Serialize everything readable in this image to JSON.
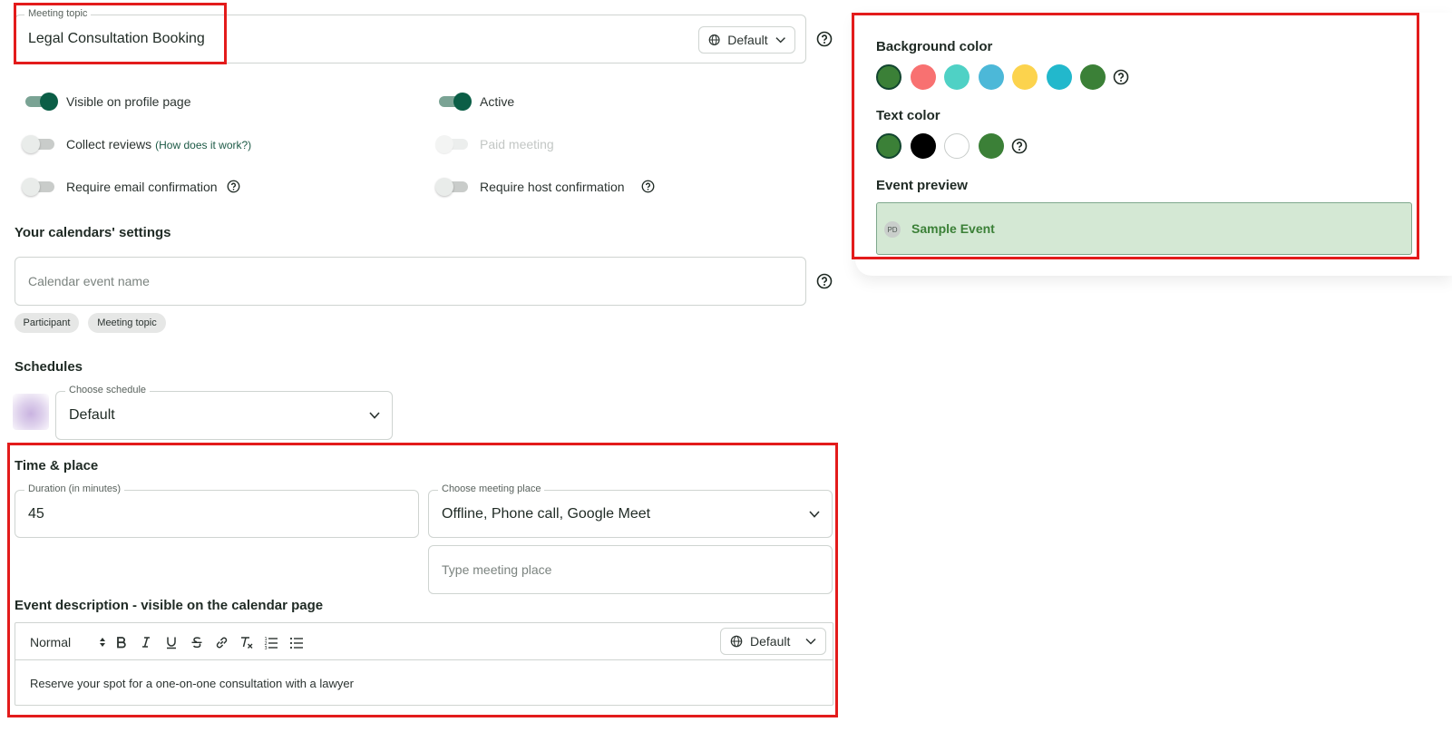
{
  "meeting_topic": {
    "label": "Meeting topic",
    "value": "Legal Consultation Booking",
    "locale": "Default"
  },
  "toggles": {
    "visible_on_profile": {
      "label": "Visible on profile page",
      "on": true
    },
    "active": {
      "label": "Active",
      "on": true
    },
    "collect_reviews": {
      "label": "Collect reviews",
      "link": "(How does it work?)",
      "on": false
    },
    "paid_meeting": {
      "label": "Paid meeting",
      "on": false,
      "disabled": true
    },
    "require_email": {
      "label": "Require email confirmation",
      "on": false
    },
    "require_host": {
      "label": "Require host confirmation",
      "on": false
    }
  },
  "calendar_settings": {
    "title": "Your calendars' settings",
    "event_name_placeholder": "Calendar event name",
    "chips": [
      "Participant",
      "Meeting topic"
    ]
  },
  "schedules": {
    "title": "Schedules",
    "label": "Choose schedule",
    "value": "Default"
  },
  "time_place": {
    "title": "Time & place",
    "duration_label": "Duration (in minutes)",
    "duration_value": "45",
    "place_label": "Choose meeting place",
    "place_value": "Offline, Phone call, Google Meet",
    "place_type_placeholder": "Type meeting place"
  },
  "description": {
    "title": "Event description - visible on the calendar page",
    "format": "Normal",
    "locale": "Default",
    "body": "Reserve your spot for a one-on-one consultation with a lawyer"
  },
  "appearance": {
    "background_title": "Background color",
    "background_colors": [
      "#3b8037",
      "#f87171",
      "#4fd1c5",
      "#4cb8d8",
      "#fcd34d",
      "#22b8cc",
      "#3b8037"
    ],
    "text_title": "Text color",
    "text_colors": [
      "#3b8037",
      "#000000",
      "#ffffff",
      "#3b8037"
    ],
    "preview_title": "Event preview",
    "preview_avatar": "PD",
    "preview_event": "Sample Event",
    "preview_bg": "#d4e8d4",
    "preview_text_color": "#3b8037"
  }
}
